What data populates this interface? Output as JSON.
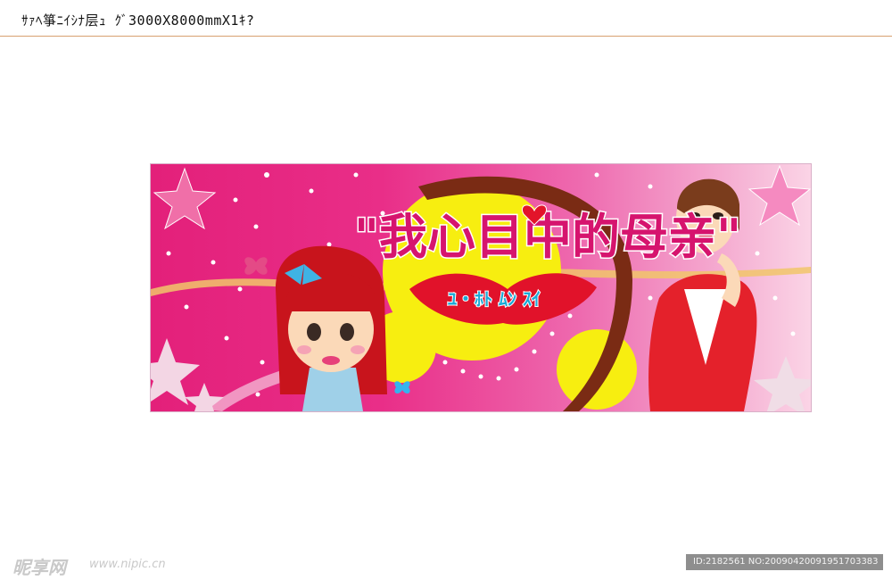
{
  "header": {
    "label": "ｻｧﾍ箏ﾆｲｼﾅ层ｭ ｸﾞ3000X8000mmX1ｷ?"
  },
  "banner": {
    "title": "\"我心目中的母亲\"",
    "subtitle": "ﾕ・ﾎﾄ ﾑﾝ ｽｲ",
    "colors": {
      "background_left": "#e3207a",
      "background_right": "#fbd4e6",
      "title_fill": "#d6146e",
      "subtitle_fill": "#1aa9d6",
      "sun_yellow": "#f7ee10",
      "mother_dress": "#e4212b",
      "girl_hair": "#c8141c"
    }
  },
  "watermark": {
    "logo": "昵享网",
    "url": "www.nipic.cn",
    "id_text": "ID:2182561 NO:20090420091951703383"
  }
}
